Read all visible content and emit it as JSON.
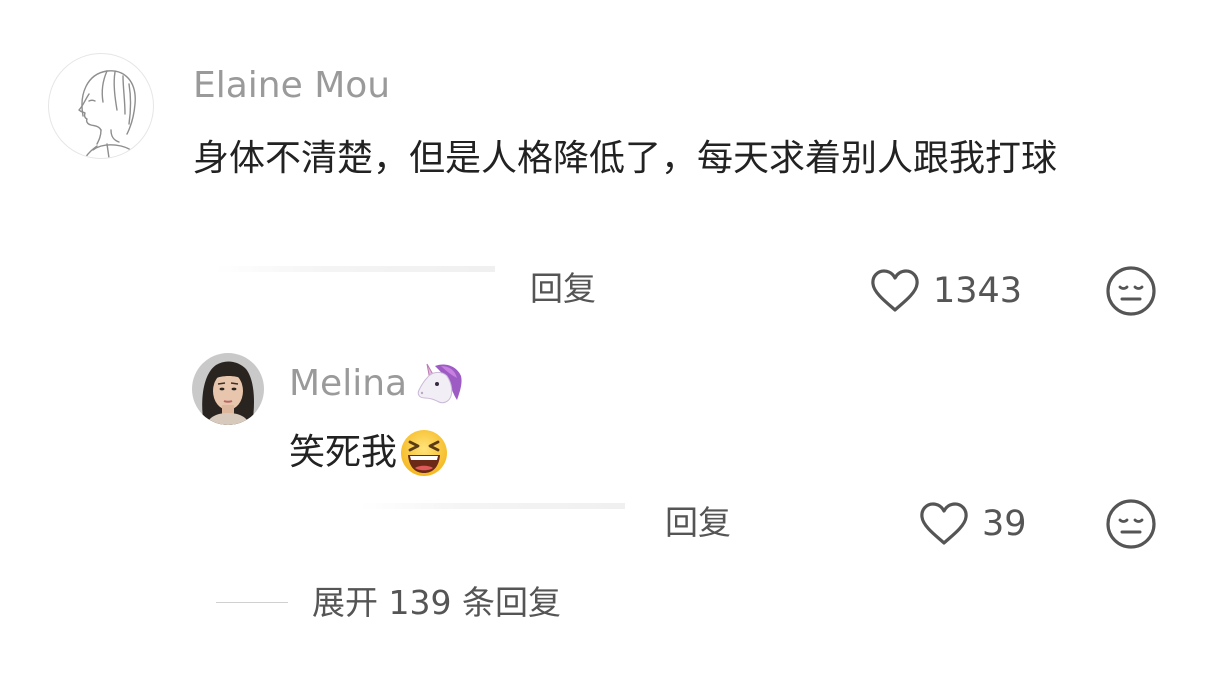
{
  "comments": [
    {
      "author": "Elaine Mou",
      "text": "身体不清楚，但是人格降低了，每天求着别人跟我打球",
      "reply_label": "回复",
      "like_count": "1343",
      "avatar": "sketch-portrait-avatar"
    }
  ],
  "replies": [
    {
      "author": "Melina",
      "author_badge": "unicorn-emoji",
      "text": "笑死我",
      "text_emoji": "laughing-face-emoji",
      "reply_label": "回复",
      "like_count": "39",
      "avatar": "photo-avatar"
    }
  ],
  "expand": {
    "label": "展开 139 条回复"
  },
  "icons": {
    "like": "heart-outline-icon",
    "dislike": "neutral-face-icon"
  },
  "colors": {
    "author_name": "#9a9a9a",
    "body_text": "#222222",
    "action_text": "#555555",
    "icon_stroke": "#555555"
  }
}
